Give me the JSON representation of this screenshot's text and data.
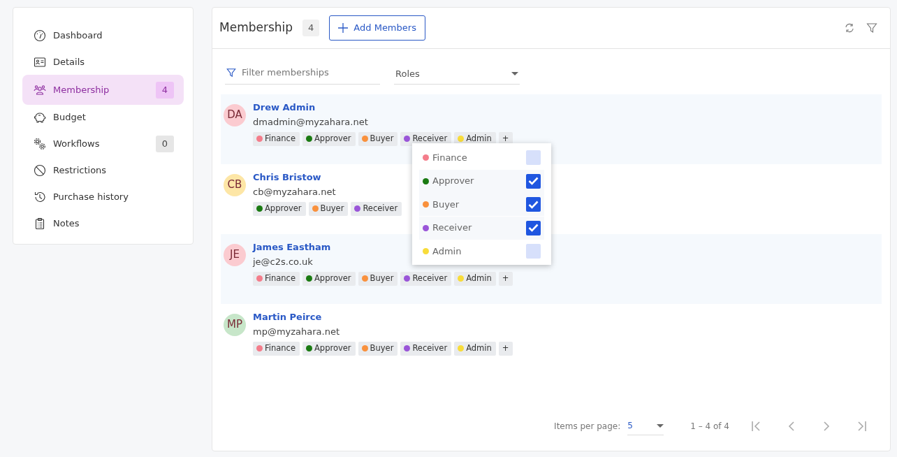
{
  "sidebar": {
    "items": [
      {
        "label": "Dashboard",
        "selected": false
      },
      {
        "label": "Details",
        "selected": false
      },
      {
        "label": "Membership",
        "selected": true,
        "count": "4"
      },
      {
        "label": "Budget",
        "selected": false
      },
      {
        "label": "Workflows",
        "selected": false,
        "count": "0"
      },
      {
        "label": "Restrictions",
        "selected": false
      },
      {
        "label": "Purchase history",
        "selected": false
      },
      {
        "label": "Notes",
        "selected": false
      }
    ]
  },
  "header": {
    "title": "Membership",
    "count": "4",
    "add_button": "Add Members"
  },
  "filter": {
    "placeholder": "Filter memberships",
    "roles_label": "Roles"
  },
  "members": [
    {
      "initials": "DA",
      "name": "Drew Admin",
      "email": "dmadmin@myzahara.net",
      "tags": [
        {
          "label": "Finance",
          "color": "#f47d8b"
        },
        {
          "label": "Approver",
          "color": "#1a7a12"
        },
        {
          "label": "Buyer",
          "color": "#f9913d"
        },
        {
          "label": "Receiver",
          "color": "#9a55d8"
        },
        {
          "label": "Admin",
          "color": "#f8dc3a"
        }
      ],
      "more": "+"
    },
    {
      "initials": "CB",
      "name": "Chris Bristow",
      "email": "cb@myzahara.net",
      "tags": [
        {
          "label": "Approver",
          "color": "#1a7a12"
        },
        {
          "label": "Buyer",
          "color": "#f9913d"
        },
        {
          "label": "Receiver",
          "color": "#9a55d8"
        }
      ]
    },
    {
      "initials": "JE",
      "name": "James Eastham",
      "email": "je@c2s.co.uk",
      "tags": [
        {
          "label": "Finance",
          "color": "#f47d8b"
        },
        {
          "label": "Approver",
          "color": "#1a7a12"
        },
        {
          "label": "Buyer",
          "color": "#f9913d"
        },
        {
          "label": "Receiver",
          "color": "#9a55d8"
        },
        {
          "label": "Admin",
          "color": "#f8dc3a"
        }
      ],
      "more": "+"
    },
    {
      "initials": "MP",
      "name": "Martin Peirce",
      "email": "mp@myzahara.net",
      "tags": [
        {
          "label": "Finance",
          "color": "#f47d8b"
        },
        {
          "label": "Approver",
          "color": "#1a7a12"
        },
        {
          "label": "Buyer",
          "color": "#f9913d"
        },
        {
          "label": "Receiver",
          "color": "#9a55d8"
        },
        {
          "label": "Admin",
          "color": "#f8dc3a"
        }
      ],
      "more": "+"
    }
  ],
  "role_menu": [
    {
      "label": "Finance",
      "color": "#f47d8b",
      "checked": false
    },
    {
      "label": "Approver",
      "color": "#1a7a12",
      "checked": true
    },
    {
      "label": "Buyer",
      "color": "#f9913d",
      "checked": true
    },
    {
      "label": "Receiver",
      "color": "#9a55d8",
      "checked": true
    },
    {
      "label": "Admin",
      "color": "#f8dc3a",
      "checked": false
    }
  ],
  "pagination": {
    "items_per_page_label": "Items per page:",
    "page_size": "5",
    "range": "1 – 4 of 4"
  }
}
